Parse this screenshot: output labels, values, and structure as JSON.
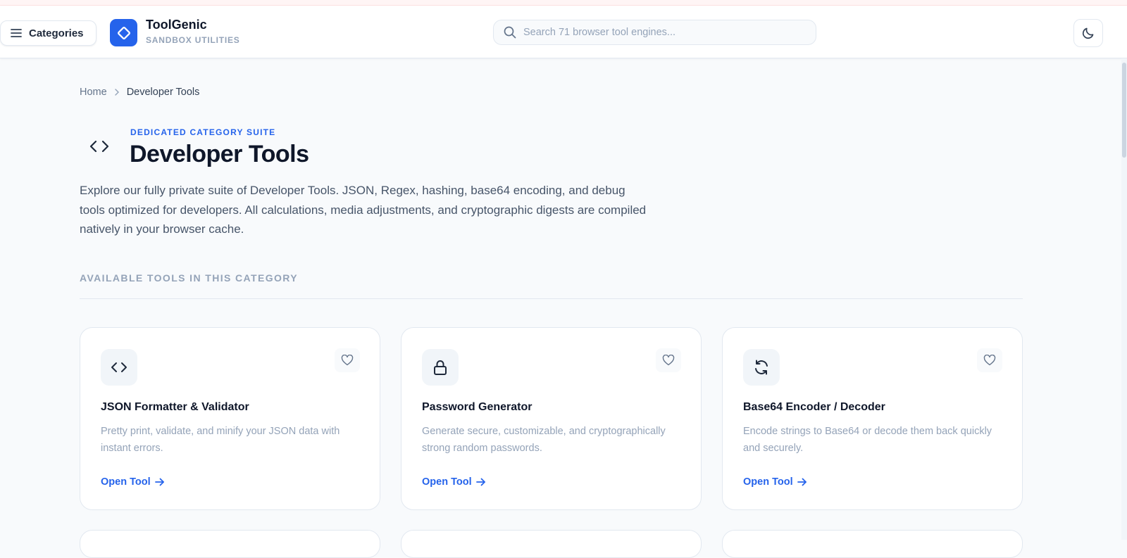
{
  "header": {
    "categories_label": "Categories",
    "brand_name": "ToolGenic",
    "brand_sub": "SANDBOX UTILITIES",
    "search_placeholder": "Search 71 browser tool engines...",
    "search_value": ""
  },
  "breadcrumb": {
    "home": "Home",
    "current": "Developer Tools"
  },
  "hero": {
    "eyebrow": "DEDICATED CATEGORY SUITE",
    "title": "Developer Tools",
    "description": "Explore our fully private suite of Developer Tools. JSON, Regex, hashing, base64 encoding, and debug tools optimized for developers. All calculations, media adjustments, and cryptographic digests are compiled natively in your browser cache."
  },
  "section_label": "AVAILABLE TOOLS IN THIS CATEGORY",
  "tools": [
    {
      "icon": "code-icon",
      "title": "JSON Formatter & Validator",
      "description": "Pretty print, validate, and minify your JSON data with instant errors.",
      "link_label": "Open Tool"
    },
    {
      "icon": "lock-icon",
      "title": "Password Generator",
      "description": "Generate secure, customizable, and cryptographically strong random passwords.",
      "link_label": "Open Tool"
    },
    {
      "icon": "refresh-icon",
      "title": "Base64 Encoder / Decoder",
      "description": "Encode strings to Base64 or decode them back quickly and securely.",
      "link_label": "Open Tool"
    }
  ],
  "colors": {
    "accent": "#2563eb",
    "background": "#f8fafc",
    "card": "#ffffff",
    "muted_text": "#94a3b8"
  }
}
